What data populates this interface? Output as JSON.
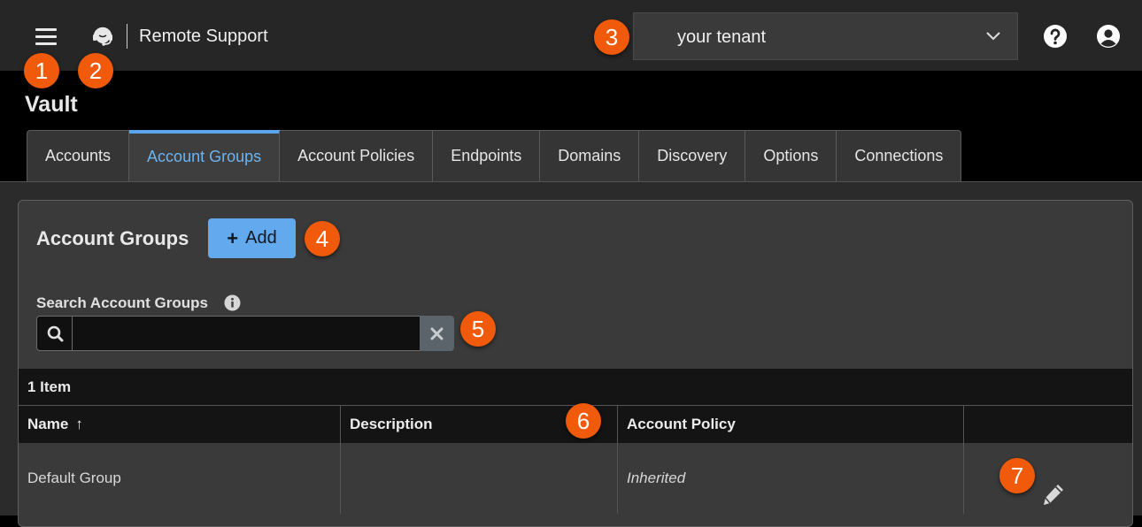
{
  "topbar": {
    "menu_icon": "hamburger-menu-icon",
    "support_icon": "headset-icon",
    "app_title": "Remote Support",
    "tenant": {
      "selected": "your tenant"
    },
    "help_icon": "help-circle-icon",
    "user_icon": "user-account-icon"
  },
  "page": {
    "title": "Vault"
  },
  "tabs": [
    {
      "label": "Accounts"
    },
    {
      "label": "Account Groups",
      "active": true
    },
    {
      "label": "Account Policies"
    },
    {
      "label": "Endpoints"
    },
    {
      "label": "Domains"
    },
    {
      "label": "Discovery"
    },
    {
      "label": "Options"
    },
    {
      "label": "Connections"
    }
  ],
  "panel": {
    "heading": "Account Groups",
    "add_label": "Add",
    "search": {
      "label": "Search Account Groups",
      "value": "",
      "placeholder": ""
    }
  },
  "table": {
    "count_label": "1 Item",
    "columns": [
      "Name",
      "Description",
      "Account Policy",
      ""
    ],
    "sort_indicator": "↑",
    "rows": [
      {
        "name": "Default Group",
        "description": "",
        "account_policy": "Inherited"
      }
    ]
  },
  "callouts": [
    "1",
    "2",
    "3",
    "4",
    "5",
    "6",
    "7"
  ],
  "colors": {
    "accent": "#5aa6ee",
    "add_button": "#63a9ee",
    "callout": "#f05a0a"
  }
}
